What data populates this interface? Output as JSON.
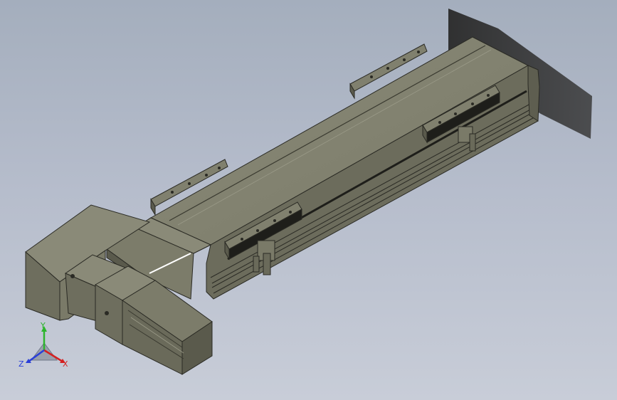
{
  "viewport": {
    "background_top": "#a4aebd",
    "background_bottom": "#c8cdd8"
  },
  "model": {
    "body_color": "#7c7c6a",
    "dark_color": "#3a3a34",
    "highlight_color": "#ffffff",
    "shadow_color": "#2e2e2e"
  },
  "triad": {
    "labels": {
      "y": "Y",
      "x": "X",
      "z": "Z"
    },
    "colors": {
      "y": "#2db52d",
      "x": "#d42020",
      "z": "#2a3fd8"
    }
  }
}
